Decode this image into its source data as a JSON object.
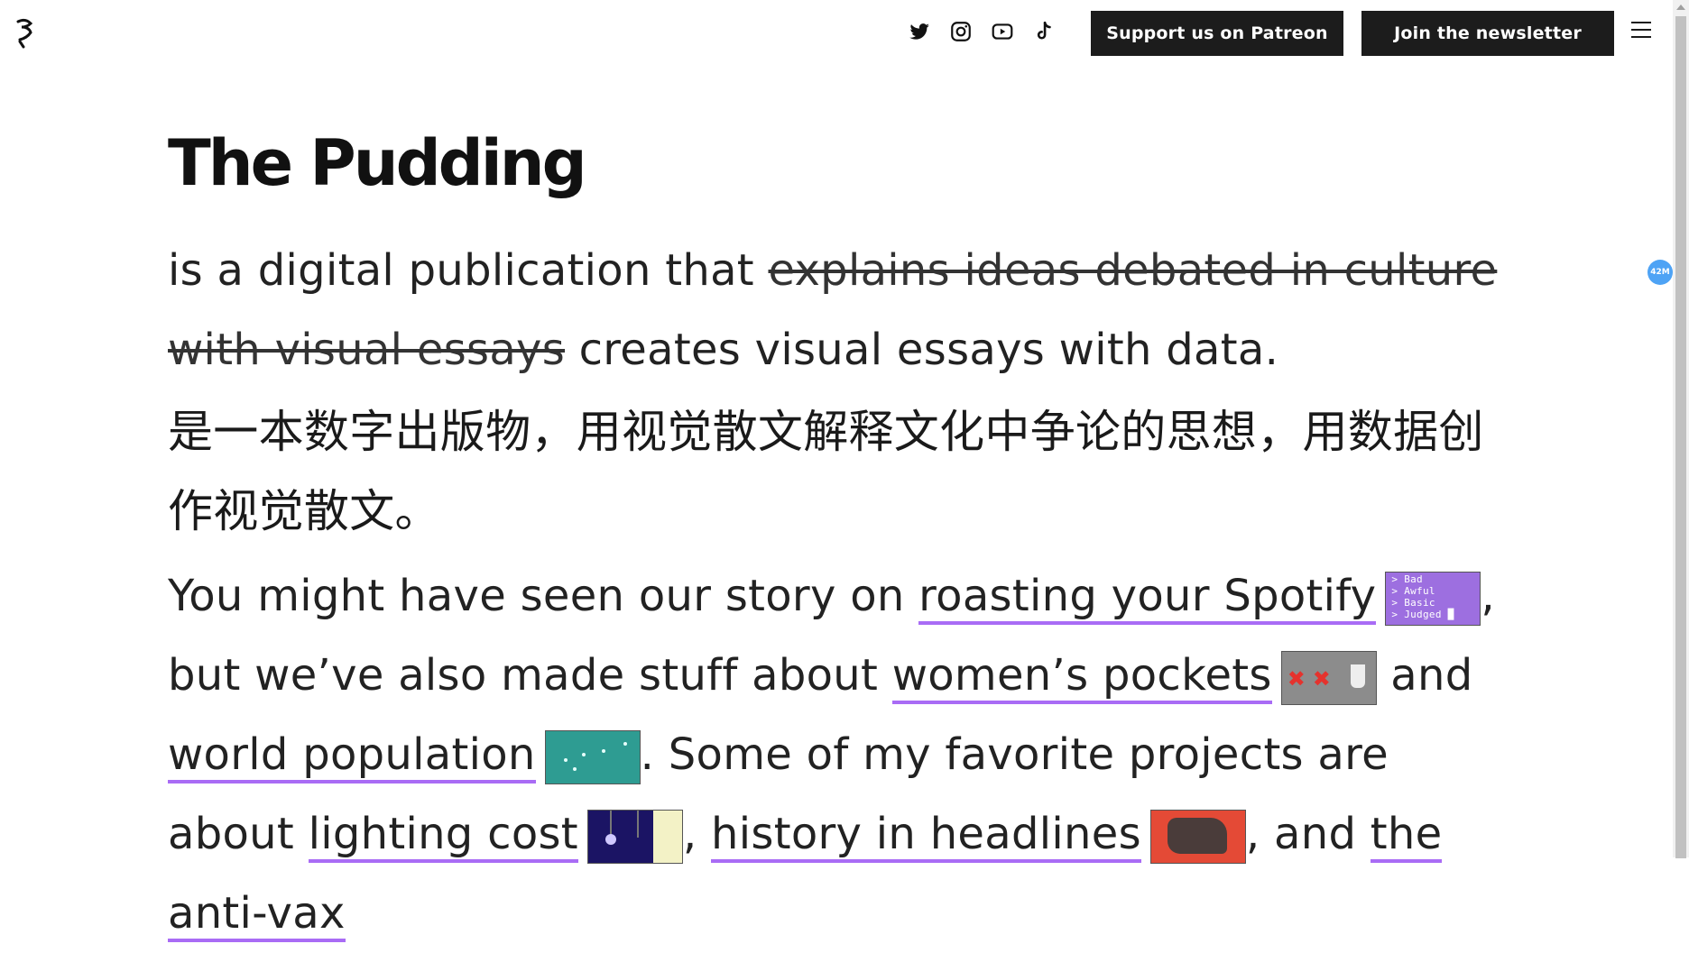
{
  "header": {
    "patreon_label": "Support us on Patreon",
    "newsletter_label": "Join the newsletter",
    "social_icons": [
      "twitter-icon",
      "instagram-icon",
      "youtube-icon",
      "tiktok-icon"
    ]
  },
  "badge": {
    "text": "42M"
  },
  "title": "The Pudding",
  "intro": {
    "lead": "is a digital publication that ",
    "struck": "explains ideas debated in culture with visual essays",
    "tail": " creates visual essays with data."
  },
  "chinese": "是一本数字出版物，用视觉散文解释文化中争论的思想，用数据创作视觉散文。",
  "stories": {
    "t1": "You might have seen our story on ",
    "link_spotify": "roasting your Spotify",
    "spotify_thumb_lines": [
      "> Bad",
      "> Awful",
      "> Basic",
      "> Judged █"
    ],
    "t2": ", but we’ve also made stuff about ",
    "link_pockets": "women’s pockets",
    "t3": " and ",
    "link_population": "world population",
    "t4": ". Some of my favorite projects are about ",
    "link_lighting": "lighting cost",
    "t5": ", ",
    "link_headlines": "history in headlines",
    "t6": ", and ",
    "link_antivax": "the anti-vax"
  },
  "colors": {
    "link_underline": "#a96cf5",
    "button_bg": "#1c1c1c",
    "badge_bg": "#4ea3f5"
  }
}
